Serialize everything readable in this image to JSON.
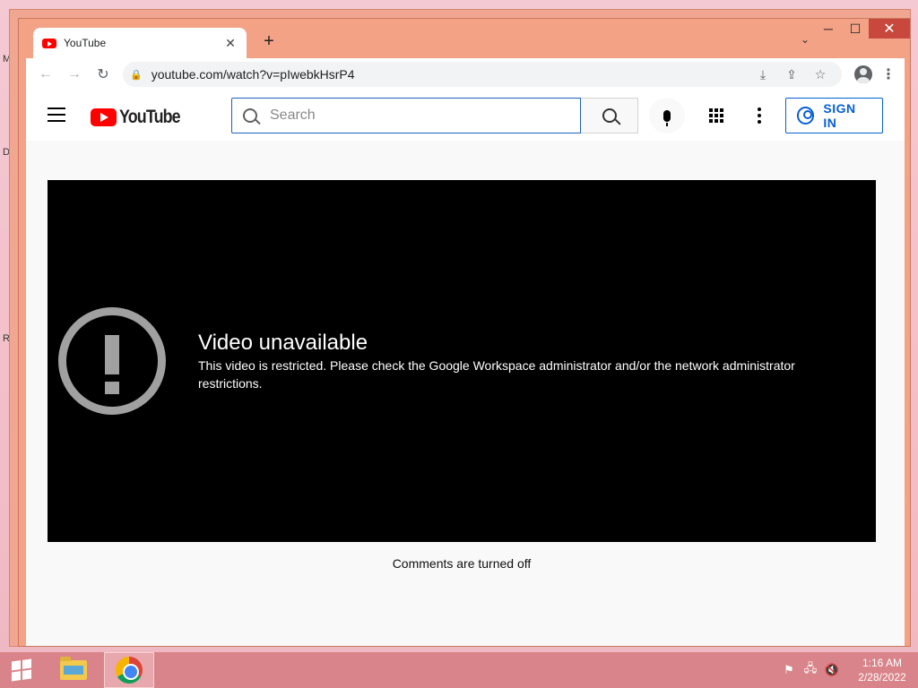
{
  "desktop": {
    "edge_letters": [
      "M",
      "D",
      "R"
    ]
  },
  "window": {
    "minimize_glyph": "─",
    "maximize_glyph": "☐",
    "close_glyph": "✕"
  },
  "tab": {
    "title": "YouTube",
    "close_glyph": "✕",
    "new_tab_glyph": "+",
    "tab_search_glyph": "⌄"
  },
  "toolbar": {
    "back_glyph": "←",
    "forward_glyph": "→",
    "reload_glyph": "↻",
    "lock_glyph": "🔒",
    "url": "youtube.com/watch?v=pIwebkHsrP4",
    "install_glyph": "⤓",
    "share_glyph": "⇪",
    "bookmark_glyph": "☆",
    "menu_glyph": "⋮"
  },
  "youtube": {
    "logo_text": "YouTube",
    "search_placeholder": "Search",
    "sign_in_label": "SIGN IN"
  },
  "player": {
    "error_title": "Video unavailable",
    "error_message": "This video is restricted. Please check the Google Workspace administrator and/or the network administrator restrictions."
  },
  "comments_notice": "Comments are turned off",
  "taskbar": {
    "time": "1:16 AM",
    "date": "2/28/2022",
    "tray_flag_glyph": "⚑",
    "tray_network_glyph": "🖧",
    "tray_volume_glyph": "🔇"
  },
  "colors": {
    "youtube_red": "#ff0000",
    "link_blue": "#065fd4",
    "window_frame": "#f3a286",
    "taskbar": "#d9848a"
  }
}
